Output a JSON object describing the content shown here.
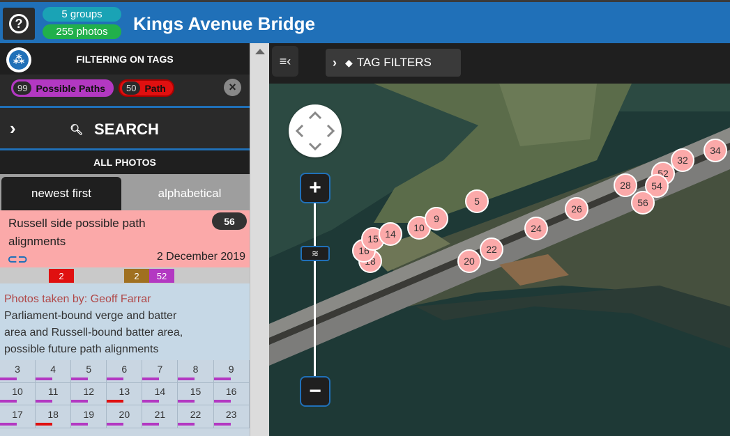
{
  "header": {
    "groups": "5 groups",
    "photos": "255 photos",
    "title": "Kings Avenue Bridge"
  },
  "filter": {
    "title": "FILTERING ON TAGS",
    "tags": [
      {
        "count": "99",
        "name": "Possible Paths",
        "color": "#b338c2"
      },
      {
        "count": "50",
        "name": "Path",
        "color": "#e01010"
      }
    ]
  },
  "search": {
    "label": "SEARCH"
  },
  "all_photos": "ALL PHOTOS",
  "sort": {
    "newest": "newest first",
    "alpha": "alphabetical"
  },
  "group": {
    "title": "Russell side possible path alignments",
    "count": "56",
    "date": "2 December 2019",
    "tag_counts": [
      {
        "value": "2",
        "color": "#e01010"
      },
      {
        "value": "2",
        "color": "#a07020"
      },
      {
        "value": "52",
        "color": "#b338c2"
      }
    ],
    "photographer": "Photos taken by: Geoff Farrar",
    "description": "Parliament-bound verge and batter area and Russell-bound batter area, possible future path alignments"
  },
  "photo_grid": [
    "3",
    "4",
    "5",
    "6",
    "7",
    "8",
    "9",
    "10",
    "11",
    "12",
    "13",
    "14",
    "15",
    "16",
    "17",
    "18",
    "19",
    "20",
    "21",
    "22",
    "23"
  ],
  "map": {
    "tag_filters": "TAG FILTERS",
    "markers": [
      "34",
      "32",
      "52",
      "28",
      "54",
      "56",
      "26",
      "24",
      "22",
      "20",
      "18",
      "16",
      "15",
      "14",
      "10",
      "9",
      "5"
    ]
  }
}
